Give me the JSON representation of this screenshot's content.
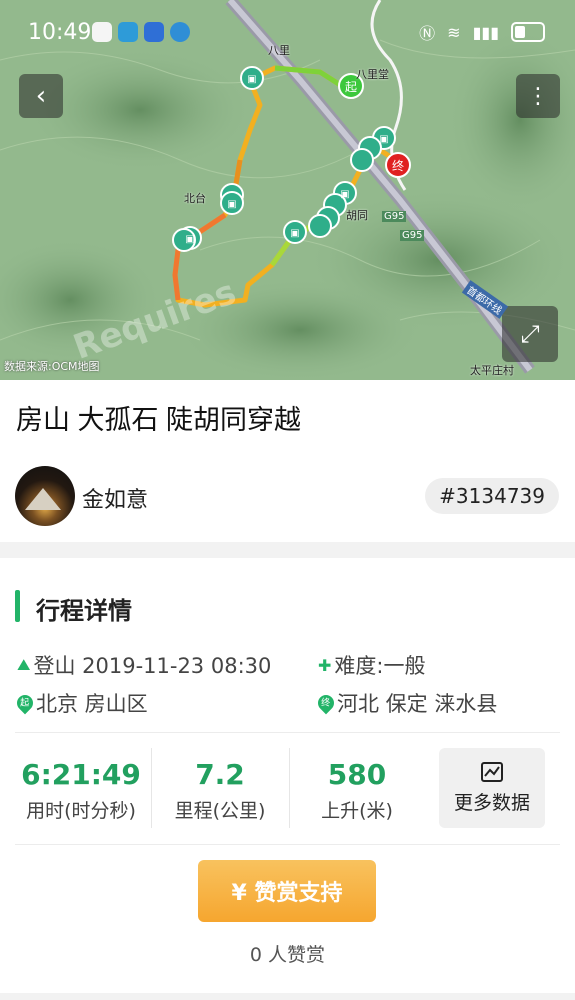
{
  "status_bar": {
    "time": "10:49"
  },
  "map": {
    "source_label": "数据来源:OCM地图",
    "watermark": "Requires",
    "start_marker": "起",
    "end_marker": "终",
    "place_labels": [
      "八里",
      "八里堂",
      "北台",
      "胡同",
      "G95",
      "G95",
      "首都环线",
      "太平庄村"
    ]
  },
  "route": {
    "title": "房山 大孤石 陡胡同穿越",
    "author": "金如意",
    "id": "#3134739"
  },
  "details": {
    "section_title": "行程详情",
    "activity": "登山 2019-11-23 08:30",
    "difficulty": "难度:一般",
    "start_location": "北京 房山区",
    "end_location": "河北 保定 涞水县",
    "start_icon_label": "起",
    "end_icon_label": "终"
  },
  "stats": {
    "duration_value": "6:21:49",
    "duration_label": "用时(时分秒)",
    "distance_value": "7.2",
    "distance_label": "里程(公里)",
    "ascent_value": "580",
    "ascent_label": "上升(米)",
    "more_label": "更多数据"
  },
  "reward": {
    "button_label": "¥ 赞赏支持",
    "count_text": "0 人赞赏"
  },
  "colors": {
    "accent_green": "#22b468",
    "reward_orange": "#f6a62f"
  }
}
